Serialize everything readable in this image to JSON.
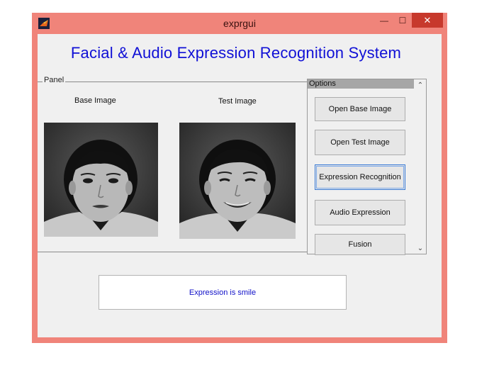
{
  "window": {
    "title": "exprgui",
    "minimize_glyph": "—",
    "maximize_glyph": "☐",
    "close_glyph": "✕"
  },
  "main": {
    "heading": "Facial & Audio Expression Recognition System",
    "panel_title": "Panel",
    "base_caption": "Base Image",
    "test_caption": "Test Image"
  },
  "options": {
    "title": "Options",
    "scroll_up_glyph": "⌃",
    "scroll_down_glyph": "⌄",
    "buttons": [
      {
        "label": "Open Base Image"
      },
      {
        "label": "Open Test Image"
      },
      {
        "label": "Expression Recognition"
      },
      {
        "label": "Audio Expression"
      },
      {
        "label": "Fusion"
      }
    ]
  },
  "result": {
    "text": "Expression is smile"
  },
  "colors": {
    "titlebar": "#f0847a",
    "close": "#c7392c",
    "heading": "#1010d6",
    "result_text": "#1010c8"
  }
}
